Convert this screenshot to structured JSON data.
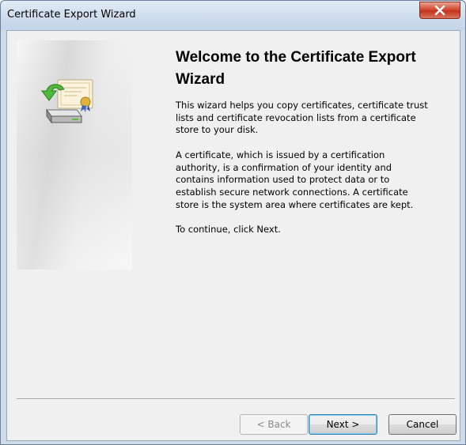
{
  "window": {
    "title": "Certificate Export Wizard",
    "close_icon": "close-icon"
  },
  "side_panel": {
    "icon": "certificate-export-icon"
  },
  "content": {
    "heading": "Welcome to the Certificate Export Wizard",
    "paragraph1": "This wizard helps you copy certificates, certificate trust lists and certificate revocation lists from a certificate store to your disk.",
    "paragraph2": "A certificate, which is issued by a certification authority, is a confirmation of your identity and contains information used to protect data or to establish secure network connections. A certificate store is the system area where certificates are kept.",
    "paragraph3": "To continue, click Next."
  },
  "buttons": {
    "back_label": "< Back",
    "back_enabled": false,
    "next_label": "Next >",
    "cancel_label": "Cancel"
  },
  "colors": {
    "close_button": "#c3331d",
    "default_button_border": "#3c7fb1"
  }
}
